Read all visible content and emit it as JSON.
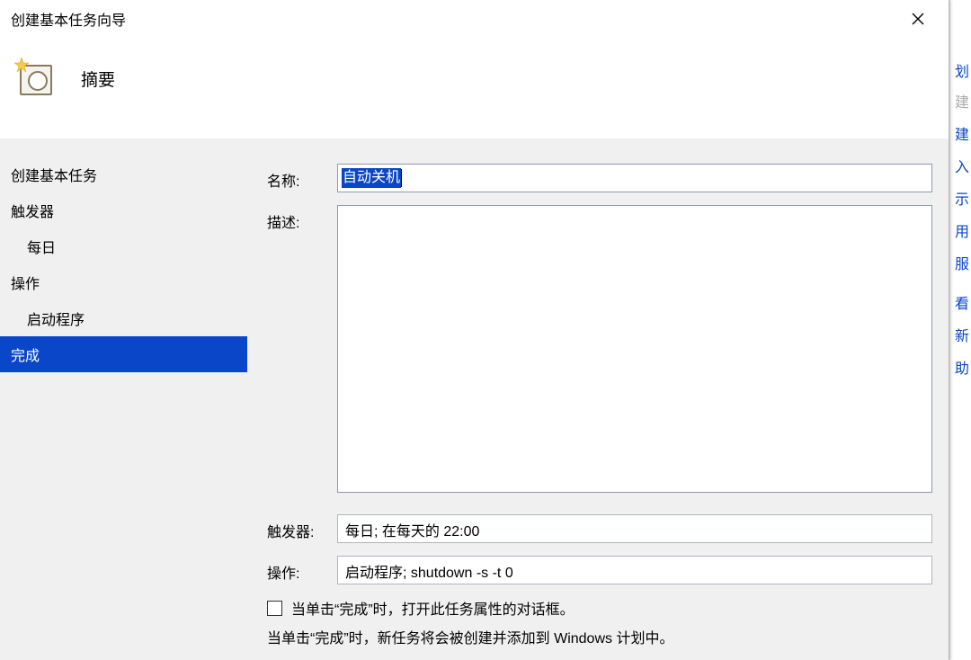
{
  "window": {
    "title": "创建基本任务向导"
  },
  "header": {
    "title": "摘要"
  },
  "sidebar": {
    "items": [
      {
        "label": "创建基本任务",
        "type": "item",
        "selected": false
      },
      {
        "label": "触发器",
        "type": "item",
        "selected": false
      },
      {
        "label": "每日",
        "type": "subitem",
        "selected": false
      },
      {
        "label": "操作",
        "type": "item",
        "selected": false
      },
      {
        "label": "启动程序",
        "type": "subitem",
        "selected": false
      },
      {
        "label": "完成",
        "type": "item",
        "selected": true
      }
    ]
  },
  "form": {
    "name_label": "名称:",
    "name_value": "自动关机",
    "desc_label": "描述:",
    "desc_value": "",
    "trigger_label": "触发器:",
    "trigger_value": "每日;  在每天的 22:00",
    "action_label": "操作:",
    "action_value": "启动程序; shutdown -s -t 0",
    "checkbox_label": "当单击“完成”时，打开此任务属性的对话框。",
    "cutoff_line": "当单击“完成”时，新任务将会被创建并添加到 Windows 计划中。"
  },
  "bg": {
    "f1": "划",
    "f2": "建",
    "f3": "建",
    "f4": "入",
    "f5": "示",
    "f6": "用",
    "f7": "服",
    "f8": "看",
    "f9": "新",
    "f10": "助"
  }
}
